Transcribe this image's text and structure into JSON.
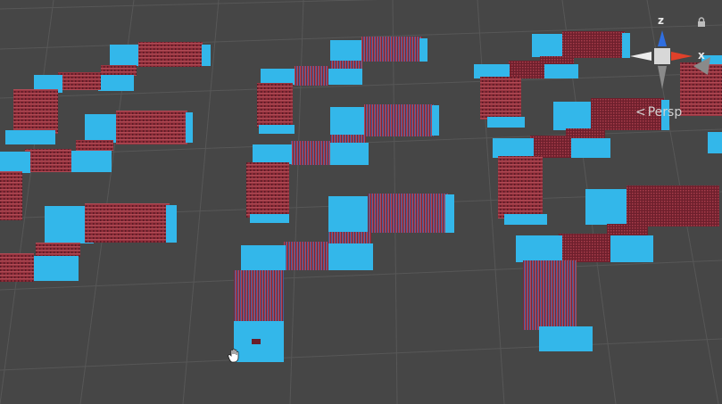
{
  "scene": {
    "view": "scene-view",
    "background_color": "#464646",
    "grid_color": "#5a5a5a",
    "tile_blue": "#33b7ea",
    "tile_red": "#8a2a36",
    "tile_red_dark": "#6a1e2a"
  },
  "gizmo": {
    "axis_x_label": "x",
    "axis_z_label": "z",
    "projection_label": "Persp",
    "x_color": "#e0412a",
    "z_color": "#2f6ee0",
    "y_color": "#8a8a8a",
    "lock_icon": "lock-icon",
    "persp_icon": "chevron-left-icon"
  },
  "cursor": {
    "icon": "pan-hand-cursor-icon"
  }
}
